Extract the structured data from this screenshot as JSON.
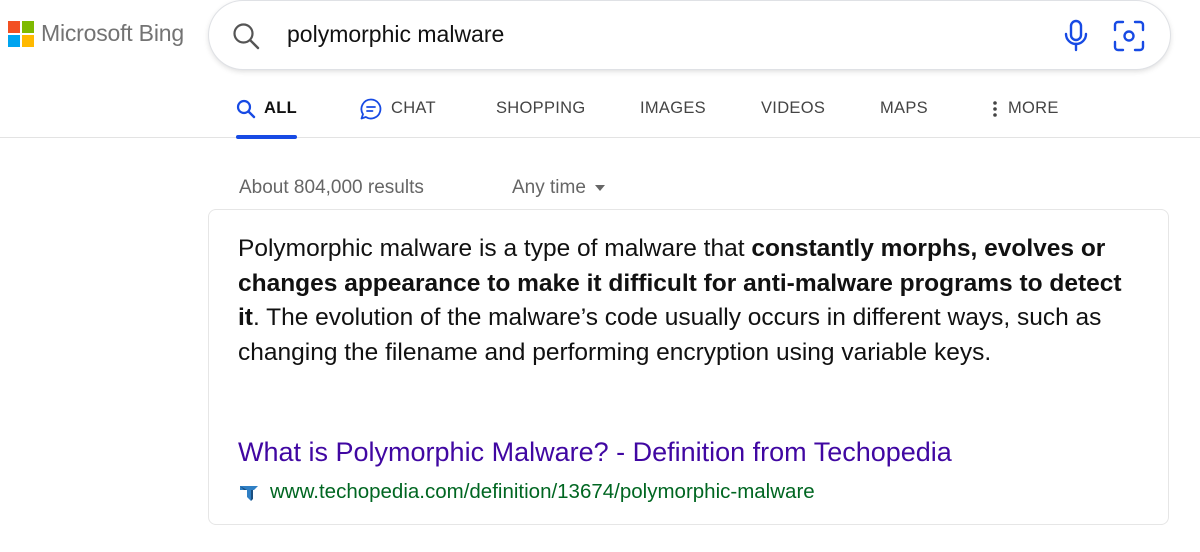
{
  "logo": {
    "text": "Microsoft Bing",
    "colors": [
      "#f25022",
      "#7fba00",
      "#00a4ef",
      "#ffb900"
    ]
  },
  "search": {
    "query": "polymorphic malware",
    "icons": [
      "search-icon",
      "microphone-icon",
      "visual-search-icon"
    ]
  },
  "tabs": [
    {
      "label": "ALL",
      "icon": "search-icon",
      "active": true
    },
    {
      "label": "CHAT",
      "icon": "chat-icon",
      "active": false
    },
    {
      "label": "SHOPPING",
      "active": false
    },
    {
      "label": "IMAGES",
      "active": false
    },
    {
      "label": "VIDEOS",
      "active": false
    },
    {
      "label": "MAPS",
      "active": false
    },
    {
      "label": "MORE",
      "icon": "more-vertical-icon",
      "active": false
    }
  ],
  "results": {
    "count_text": "About 804,000 results",
    "time_filter": "Any time"
  },
  "answer": {
    "text_part1": "Polymorphic malware is a type of malware that ",
    "text_bold": "constantly morphs, evolves or changes appearance to make it difficult for anti-malware programs to detect it",
    "text_part2": ". The evolution of the malware’s code usually occurs in different ways, such as changing the filename and performing encryption using variable keys.",
    "source_title": "What is Polymorphic Malware? - Definition from Techopedia",
    "source_url": "www.techopedia.com/definition/13674/polymorphic-malware",
    "favicon": "techopedia-favicon-icon"
  },
  "colors": {
    "accent": "#174ae4",
    "title_link": "#4007a2",
    "url_green": "#006621",
    "muted_text": "#666666"
  }
}
